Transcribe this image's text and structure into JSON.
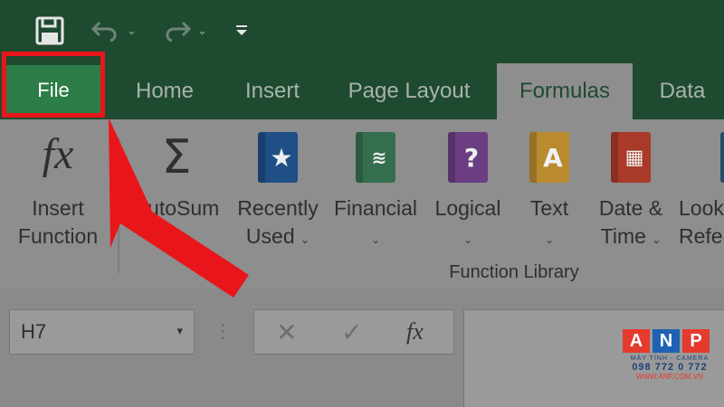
{
  "quick_access": {
    "save_icon": "save-icon",
    "undo_icon": "undo-icon",
    "redo_icon": "redo-icon",
    "customize_icon": "customize-qat-icon",
    "caret": "⌄"
  },
  "tabs": [
    {
      "label": "File"
    },
    {
      "label": "Home"
    },
    {
      "label": "Insert"
    },
    {
      "label": "Page Layout"
    },
    {
      "label": "Formulas",
      "active": true
    },
    {
      "label": "Data"
    }
  ],
  "ribbon": {
    "insert_function": {
      "line1": "Insert",
      "line2": "Function",
      "symbol": "fx"
    },
    "autosum": {
      "label": "AutoSum"
    },
    "recently_used": {
      "line1": "Recently",
      "line2": "Used"
    },
    "financial": {
      "label": "Financial"
    },
    "logical": {
      "label": "Logical"
    },
    "text": {
      "label": "Text"
    },
    "date_time": {
      "line1": "Date &",
      "line2": "Time"
    },
    "lookup": {
      "line1": "Lookup &",
      "line2": "Reference"
    },
    "group_label": "Function Library",
    "caret": "⌄"
  },
  "formula_bar": {
    "name_box": "H7",
    "dropdown": "▾",
    "cancel": "✕",
    "enter": "✓",
    "fx": "fx",
    "value": ""
  },
  "watermark": {
    "letters": [
      "A",
      "N",
      "P"
    ],
    "tagline": "MÁY TÍNH - CAMERA",
    "phone": "098 772 0 772",
    "url": "WWW.ANP.COM.VN"
  },
  "colors": {
    "excel_green": "#1e4a2f",
    "file_tab": "#2c7d48",
    "highlight_red": "#e8161b"
  }
}
